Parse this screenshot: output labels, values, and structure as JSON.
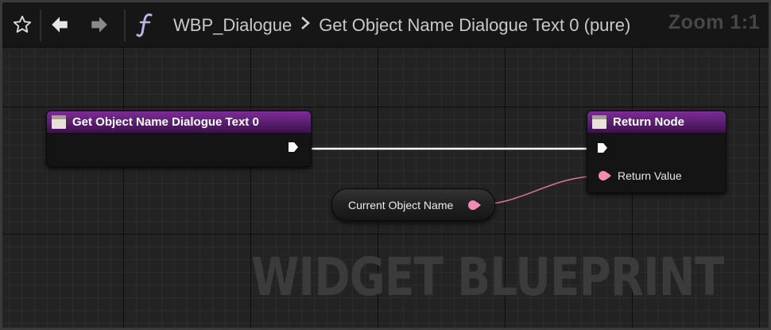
{
  "toolbar": {
    "favorite_icon": "star-icon",
    "back_icon": "arrow-left-icon",
    "forward_icon": "arrow-right-icon",
    "function_icon": "function-f-icon",
    "breadcrumb": [
      "WBP_Dialogue",
      "Get Object Name Dialogue Text 0 (pure)"
    ],
    "zoom": "Zoom 1:1"
  },
  "graph": {
    "watermark": "WIDGET BLUEPRINT",
    "nodes": {
      "function_entry": {
        "title": "Get Object Name Dialogue Text 0",
        "icon": "function-node-icon"
      },
      "return_node": {
        "title": "Return Node",
        "icon": "function-node-icon",
        "pin_label": "Return Value"
      },
      "variable_get": {
        "label": "Current Object Name"
      }
    },
    "colors": {
      "header_purple": "#6e2888",
      "exec_wire": "#ffffff",
      "text_pin": "#f28bb4"
    }
  }
}
